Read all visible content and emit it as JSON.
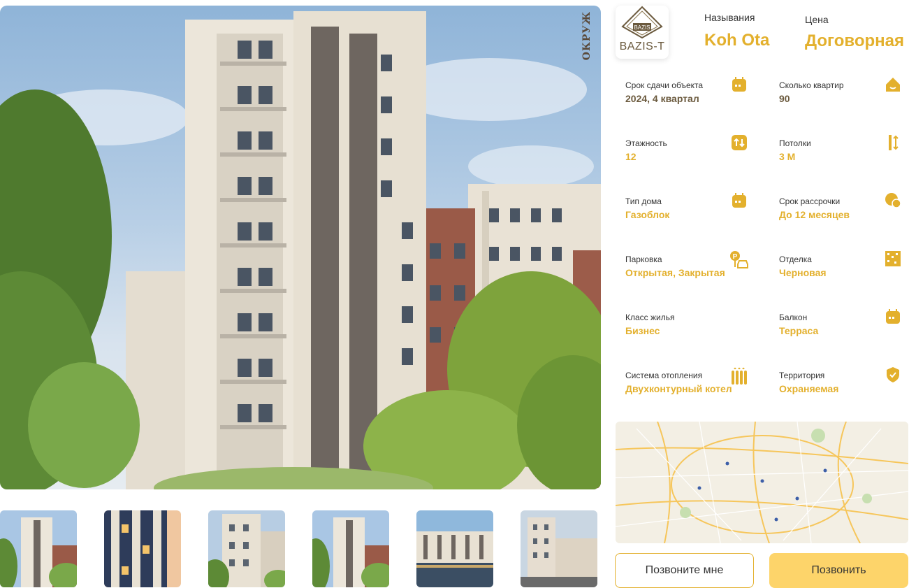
{
  "gallery": {
    "side_text": "ОКРУЖ",
    "thumbnails": [
      "thumb-1",
      "thumb-2",
      "thumb-3",
      "thumb-4",
      "thumb-5",
      "thumb-6"
    ]
  },
  "header": {
    "logo_text": "BAZIS-T",
    "logo_badge": "BAZIS",
    "name_label": "Называния",
    "name_value": "Koh Ota",
    "price_label": "Цена",
    "price_value": "Договорная"
  },
  "specs": [
    {
      "label": "Срок сдачи объекта",
      "value": "2024, 4 квартал",
      "icon": "calendar-icon"
    },
    {
      "label": "Сколько квартир",
      "value": "90",
      "icon": "home-icon"
    },
    {
      "label": "Этажность",
      "value": "12",
      "icon": "floors-icon"
    },
    {
      "label": "Потолки",
      "value": "3 М",
      "icon": "ceiling-height-icon"
    },
    {
      "label": "Тип дома",
      "value": "Газоблок",
      "icon": "calendar-icon"
    },
    {
      "label": "Срок рассрочки",
      "value": "До 12 месяцев",
      "icon": "installment-icon"
    },
    {
      "label": "Парковка",
      "value": "Открытая, Закрытая",
      "icon": "parking-icon"
    },
    {
      "label": "Отделка",
      "value": "Черновая",
      "icon": "finishing-icon"
    },
    {
      "label": "Класс жилья",
      "value": "Бизнес",
      "icon": "calendar-icon"
    },
    {
      "label": "Балкон",
      "value": "Терраса",
      "icon": "calendar-icon"
    },
    {
      "label": "Система отопления",
      "value": "Двухконтурный котел",
      "icon": "radiator-icon"
    },
    {
      "label": "Территория",
      "value": "Охраняемая",
      "icon": "shield-icon"
    }
  ],
  "buttons": {
    "call_me": "Позвоните мне",
    "call": "Позвонить"
  },
  "colors": {
    "accent": "#e3b02d",
    "button_fill": "#fdd46a",
    "brand_brown": "#6b5a3e"
  }
}
